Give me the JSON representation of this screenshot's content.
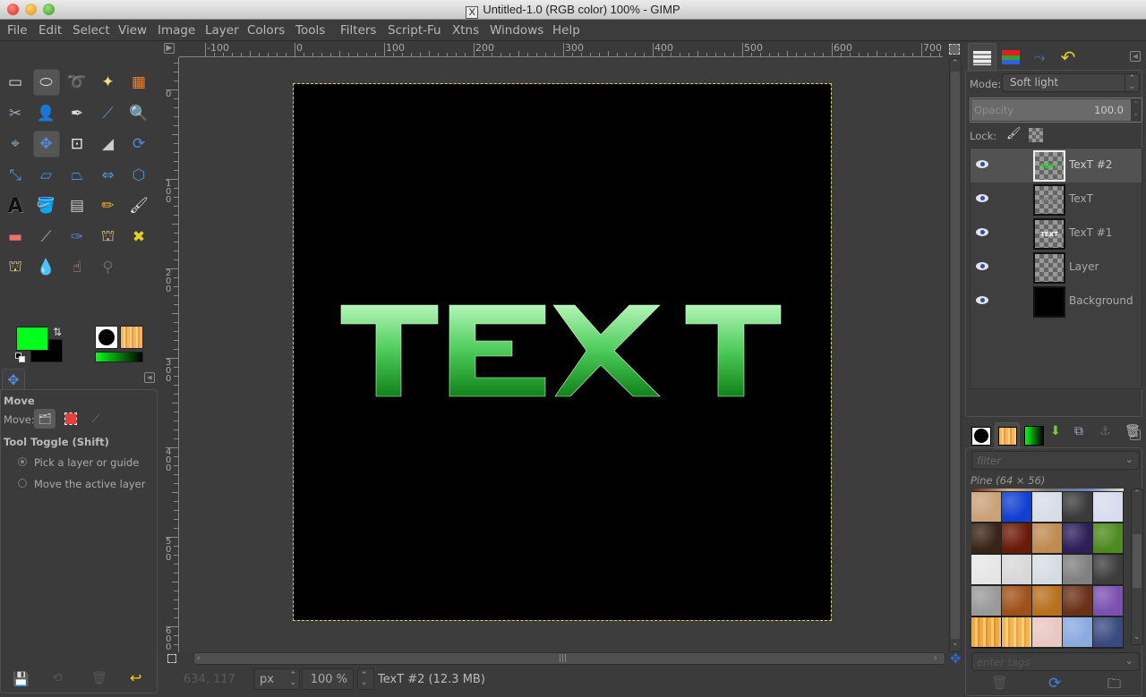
{
  "window": {
    "title": "Untitled-1.0 (RGB color) 100% - GIMP",
    "title_icon": "x11-icon"
  },
  "menubar": {
    "items": [
      "File",
      "Edit",
      "Select",
      "View",
      "Image",
      "Layer",
      "Colors",
      "Tools",
      "Filters",
      "Script-Fu",
      "Xtns",
      "Windows",
      "Help"
    ]
  },
  "toolbox": {
    "tools": [
      {
        "name": "rect-select",
        "icon": "rect-select-icon",
        "glyph": "▭",
        "active": false
      },
      {
        "name": "ellipse-select",
        "icon": "ellipse-select-icon",
        "glyph": "⬭",
        "active": true
      },
      {
        "name": "free-select",
        "icon": "lasso-icon",
        "glyph": "➰",
        "active": false
      },
      {
        "name": "fuzzy-select",
        "icon": "magic-wand-icon",
        "glyph": "✦",
        "active": false
      },
      {
        "name": "select-by-color",
        "icon": "select-by-color-icon",
        "glyph": "▦",
        "active": false
      },
      {
        "name": "scissors-select",
        "icon": "scissors-icon",
        "glyph": "✂",
        "active": false
      },
      {
        "name": "foreground-select",
        "icon": "foreground-select-icon",
        "glyph": "👤",
        "active": false
      },
      {
        "name": "paths",
        "icon": "paths-icon",
        "glyph": "✒",
        "active": false
      },
      {
        "name": "color-picker",
        "icon": "color-picker-icon",
        "glyph": "⟋",
        "active": false
      },
      {
        "name": "zoom",
        "icon": "magnifier-icon",
        "glyph": "🔍",
        "active": false
      },
      {
        "name": "measure",
        "icon": "compass-icon",
        "glyph": "⌖",
        "active": false
      },
      {
        "name": "move",
        "icon": "move-icon",
        "glyph": "✥",
        "active": true
      },
      {
        "name": "align",
        "icon": "align-icon",
        "glyph": "⊡",
        "active": false
      },
      {
        "name": "crop",
        "icon": "knife-icon",
        "glyph": "◢",
        "active": false
      },
      {
        "name": "rotate",
        "icon": "rotate-icon",
        "glyph": "⟳",
        "active": false
      },
      {
        "name": "scale",
        "icon": "scale-icon",
        "glyph": "⤡",
        "active": false
      },
      {
        "name": "shear",
        "icon": "shear-icon",
        "glyph": "▱",
        "active": false
      },
      {
        "name": "perspective",
        "icon": "perspective-icon",
        "glyph": "⏢",
        "active": false
      },
      {
        "name": "flip",
        "icon": "flip-icon",
        "glyph": "⇔",
        "active": false
      },
      {
        "name": "cage",
        "icon": "cage-icon",
        "glyph": "⬡",
        "active": false
      },
      {
        "name": "text",
        "icon": "text-tool-icon",
        "glyph": "A",
        "active": false
      },
      {
        "name": "bucket-fill",
        "icon": "bucket-icon",
        "glyph": "🪣",
        "active": false
      },
      {
        "name": "blend",
        "icon": "gradient-icon",
        "glyph": "▤",
        "active": false
      },
      {
        "name": "pencil",
        "icon": "pencil-icon",
        "glyph": "✏",
        "active": false
      },
      {
        "name": "paintbrush",
        "icon": "paintbrush-icon",
        "glyph": "🖌",
        "active": false
      },
      {
        "name": "eraser",
        "icon": "eraser-icon",
        "glyph": "▬",
        "active": false
      },
      {
        "name": "airbrush",
        "icon": "airbrush-icon",
        "glyph": "⟋",
        "active": false
      },
      {
        "name": "ink",
        "icon": "ink-icon",
        "glyph": "✑",
        "active": false
      },
      {
        "name": "clone",
        "icon": "stamp-icon",
        "glyph": "⛫",
        "active": false
      },
      {
        "name": "heal",
        "icon": "bandage-icon",
        "glyph": "✖",
        "active": false
      },
      {
        "name": "perspective-clone",
        "icon": "perspective-clone-icon",
        "glyph": "⛫",
        "active": false
      },
      {
        "name": "blur",
        "icon": "droplet-icon",
        "glyph": "💧",
        "active": false
      },
      {
        "name": "smudge",
        "icon": "smudge-icon",
        "glyph": "☝",
        "active": false
      },
      {
        "name": "dodge-burn",
        "icon": "dodge-burn-icon",
        "glyph": "⚲",
        "active": false
      }
    ],
    "fg_color": "#00ff1a",
    "bg_color": "#000000"
  },
  "tool_options": {
    "title": "Move",
    "move_label": "Move:",
    "toggle_label": "Tool Toggle  (Shift)",
    "radio_options": [
      {
        "label": "Pick a layer or guide",
        "checked": true
      },
      {
        "label": "Move the active layer",
        "checked": false
      }
    ]
  },
  "canvas": {
    "text": "TEXT",
    "hruler_labels": [
      "-100",
      "0",
      "100",
      "200",
      "300",
      "400",
      "500",
      "600",
      "700"
    ],
    "vruler_labels": [
      "0",
      "100",
      "200",
      "300",
      "400",
      "500",
      "600"
    ]
  },
  "statusbar": {
    "coords": "634, 117",
    "unit": "px",
    "zoom": "100 %",
    "layer_info": "TexT #2 (12.3 MB)"
  },
  "layers_panel": {
    "mode_label": "Mode:",
    "mode_value": "Soft light",
    "opacity_label": "Opacity",
    "opacity_value": "100.0",
    "lock_label": "Lock:",
    "layers": [
      {
        "name": "TexT #2",
        "selected": true,
        "thumb_text": "TEXT",
        "thumb_color": "#22dd22"
      },
      {
        "name": "TexT",
        "selected": false,
        "thumb_text": "TEXT",
        "thumb_color": "#777777"
      },
      {
        "name": "TexT #1",
        "selected": false,
        "thumb_text": "TEXT",
        "thumb_color": "#ffffff"
      },
      {
        "name": "Layer",
        "selected": false,
        "thumb_text": "",
        "thumb_color": ""
      },
      {
        "name": "Background",
        "selected": false,
        "thumb_text": "",
        "thumb_color": "",
        "black": true
      }
    ]
  },
  "patterns_panel": {
    "filter_placeholder": "filter",
    "pattern_name": "Pine (64 × 56)",
    "tags_placeholder": "enter tags",
    "patterns": [
      [
        "#c9a27a",
        "#1240d0",
        "#d8dde8",
        "#3a3a3a",
        "#d8dcee"
      ],
      [
        "#3a2418",
        "#6b1a08",
        "#c08a50",
        "#2e1e5a",
        "#4f8a20"
      ],
      [
        "#e6e6e6",
        "#d8d8d8",
        "#d6dde2",
        "#808080",
        "#3c3c3c"
      ],
      [
        "#999999",
        "#a0501a",
        "#b8701c",
        "#6a3018",
        "#7a50b0"
      ],
      [
        "#f0a840",
        "#f2b550",
        "#e8c8c0",
        "#8aaae0",
        "#3a4a80"
      ]
    ]
  }
}
